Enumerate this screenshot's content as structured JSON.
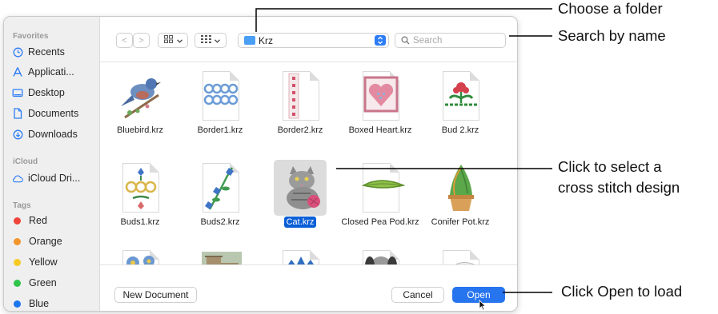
{
  "sidebar": {
    "favorites_header": "Favorites",
    "favorites": [
      {
        "label": "Recents",
        "icon": "clock-icon"
      },
      {
        "label": "Applicati...",
        "icon": "applications-icon"
      },
      {
        "label": "Desktop",
        "icon": "desktop-icon"
      },
      {
        "label": "Documents",
        "icon": "document-icon"
      },
      {
        "label": "Downloads",
        "icon": "download-icon"
      }
    ],
    "icloud_header": "iCloud",
    "icloud": [
      {
        "label": "iCloud Dri...",
        "icon": "cloud-icon"
      }
    ],
    "tags_header": "Tags",
    "tags": [
      {
        "label": "Red",
        "color": "#f0443b"
      },
      {
        "label": "Orange",
        "color": "#f2952b"
      },
      {
        "label": "Yellow",
        "color": "#f7c924"
      },
      {
        "label": "Green",
        "color": "#2fc44a"
      },
      {
        "label": "Blue",
        "color": "#1f76f1"
      }
    ]
  },
  "toolbar": {
    "back": "<",
    "forward": ">",
    "icon_view": "icon-grid-icon",
    "group_view": "group-grid-icon",
    "folder": "Krz",
    "search_placeholder": "Search"
  },
  "files": [
    {
      "name": "Bluebird.krz",
      "selected": false
    },
    {
      "name": "Border1.krz",
      "selected": false
    },
    {
      "name": "Border2.krz",
      "selected": false
    },
    {
      "name": "Boxed Heart.krz",
      "selected": false
    },
    {
      "name": "Bud 2.krz",
      "selected": false
    },
    {
      "name": "Buds1.krz",
      "selected": false
    },
    {
      "name": "Buds2.krz",
      "selected": false
    },
    {
      "name": "Cat.krz",
      "selected": true
    },
    {
      "name": "Closed Pea Pod.krz",
      "selected": false
    },
    {
      "name": "Conifer Pot.krz",
      "selected": false
    }
  ],
  "footer": {
    "new_document": "New Document",
    "cancel": "Cancel",
    "open": "Open"
  },
  "callouts": {
    "folder": "Choose a folder",
    "search": "Search by name",
    "select_line1": "Click to select a",
    "select_line2": "cross stitch design",
    "open": "Click Open to load"
  }
}
